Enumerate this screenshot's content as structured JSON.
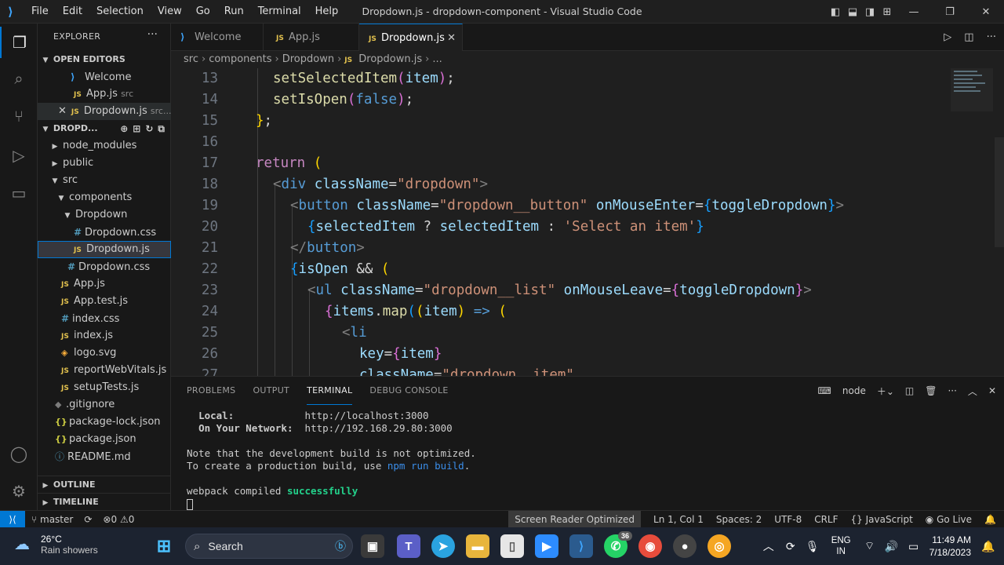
{
  "window": {
    "title": "Dropdown.js - dropdown-component - Visual Studio Code",
    "menu": [
      "File",
      "Edit",
      "Selection",
      "View",
      "Go",
      "Run",
      "Terminal",
      "Help"
    ]
  },
  "sidebar": {
    "header": "EXPLORER",
    "open_editors_label": "OPEN EDITORS",
    "open_editors": [
      {
        "label": "Welcome",
        "icon": "vscode-icon",
        "hint": ""
      },
      {
        "label": "App.js",
        "icon": "js-icon",
        "hint": "src"
      },
      {
        "label": "Dropdown.js",
        "icon": "js-icon",
        "hint": "src..."
      }
    ],
    "project_label": "DROPD...",
    "tree": [
      {
        "label": "node_modules",
        "type": "folder",
        "indent": 1
      },
      {
        "label": "public",
        "type": "folder",
        "indent": 1
      },
      {
        "label": "src",
        "type": "folder-open",
        "indent": 1
      },
      {
        "label": "components",
        "type": "folder-open",
        "indent": 2
      },
      {
        "label": "Dropdown",
        "type": "folder-open",
        "indent": 3
      },
      {
        "label": "Dropdown.css",
        "type": "css",
        "indent": 4
      },
      {
        "label": "Dropdown.js",
        "type": "js",
        "indent": 4
      },
      {
        "label": "Dropdown.css",
        "type": "css",
        "indent": 3
      },
      {
        "label": "App.js",
        "type": "js",
        "indent": 2
      },
      {
        "label": "App.test.js",
        "type": "js",
        "indent": 2
      },
      {
        "label": "index.css",
        "type": "css",
        "indent": 2
      },
      {
        "label": "index.js",
        "type": "js",
        "indent": 2
      },
      {
        "label": "logo.svg",
        "type": "svg",
        "indent": 2
      },
      {
        "label": "reportWebVitals.js",
        "type": "js",
        "indent": 2
      },
      {
        "label": "setupTests.js",
        "type": "js",
        "indent": 2
      },
      {
        "label": ".gitignore",
        "type": "git",
        "indent": 1
      },
      {
        "label": "package-lock.json",
        "type": "json",
        "indent": 1
      },
      {
        "label": "package.json",
        "type": "json",
        "indent": 1
      },
      {
        "label": "README.md",
        "type": "info",
        "indent": 1
      }
    ],
    "outline_label": "OUTLINE",
    "timeline_label": "TIMELINE"
  },
  "tabs": [
    {
      "label": "Welcome",
      "icon": "vscode-icon"
    },
    {
      "label": "App.js",
      "icon": "js-icon"
    },
    {
      "label": "Dropdown.js",
      "icon": "js-icon",
      "active": true
    }
  ],
  "breadcrumb": [
    "src",
    "components",
    "Dropdown",
    "Dropdown.js",
    "..."
  ],
  "editor": {
    "line_numbers": [
      "13",
      "14",
      "15",
      "16",
      "17",
      "18",
      "19",
      "20",
      "21",
      "22",
      "23",
      "24",
      "25",
      "26",
      "27"
    ]
  },
  "panel": {
    "tabs": [
      "PROBLEMS",
      "OUTPUT",
      "TERMINAL",
      "DEBUG CONSOLE"
    ],
    "active_tab": "TERMINAL",
    "terminal_name": "node",
    "lines": {
      "local_label": "Local:",
      "local_url": "http://localhost:3000",
      "network_label": "On Your Network:",
      "network_url": "http://192.168.29.80:3000",
      "note": "Note that the development build is not optimized.",
      "prod_prefix": "To create a production build, use ",
      "prod_cmd": "npm run build",
      "prod_suffix": ".",
      "webpack_prefix": "webpack compiled ",
      "webpack_status": "successfully"
    }
  },
  "statusbar": {
    "branch": "master",
    "errors": "0",
    "warnings": "0",
    "screen_reader": "Screen Reader Optimized",
    "position": "Ln 1, Col 1",
    "spaces": "Spaces: 2",
    "encoding": "UTF-8",
    "eol": "CRLF",
    "language": "JavaScript",
    "golive": "Go Live"
  },
  "taskbar": {
    "temp": "26°C",
    "weather": "Rain showers",
    "search_placeholder": "Search",
    "badge_count": "36",
    "lang_top": "ENG",
    "lang_bottom": "IN",
    "time": "11:49 AM",
    "date": "7/18/2023"
  },
  "colors": {
    "accent": "#0078d4",
    "editor_bg": "#1f1f1f",
    "keyword": "#c586c0",
    "function": "#dcdcaa",
    "variable": "#9cdcfe",
    "string": "#ce9178",
    "tag": "#569cd6"
  }
}
